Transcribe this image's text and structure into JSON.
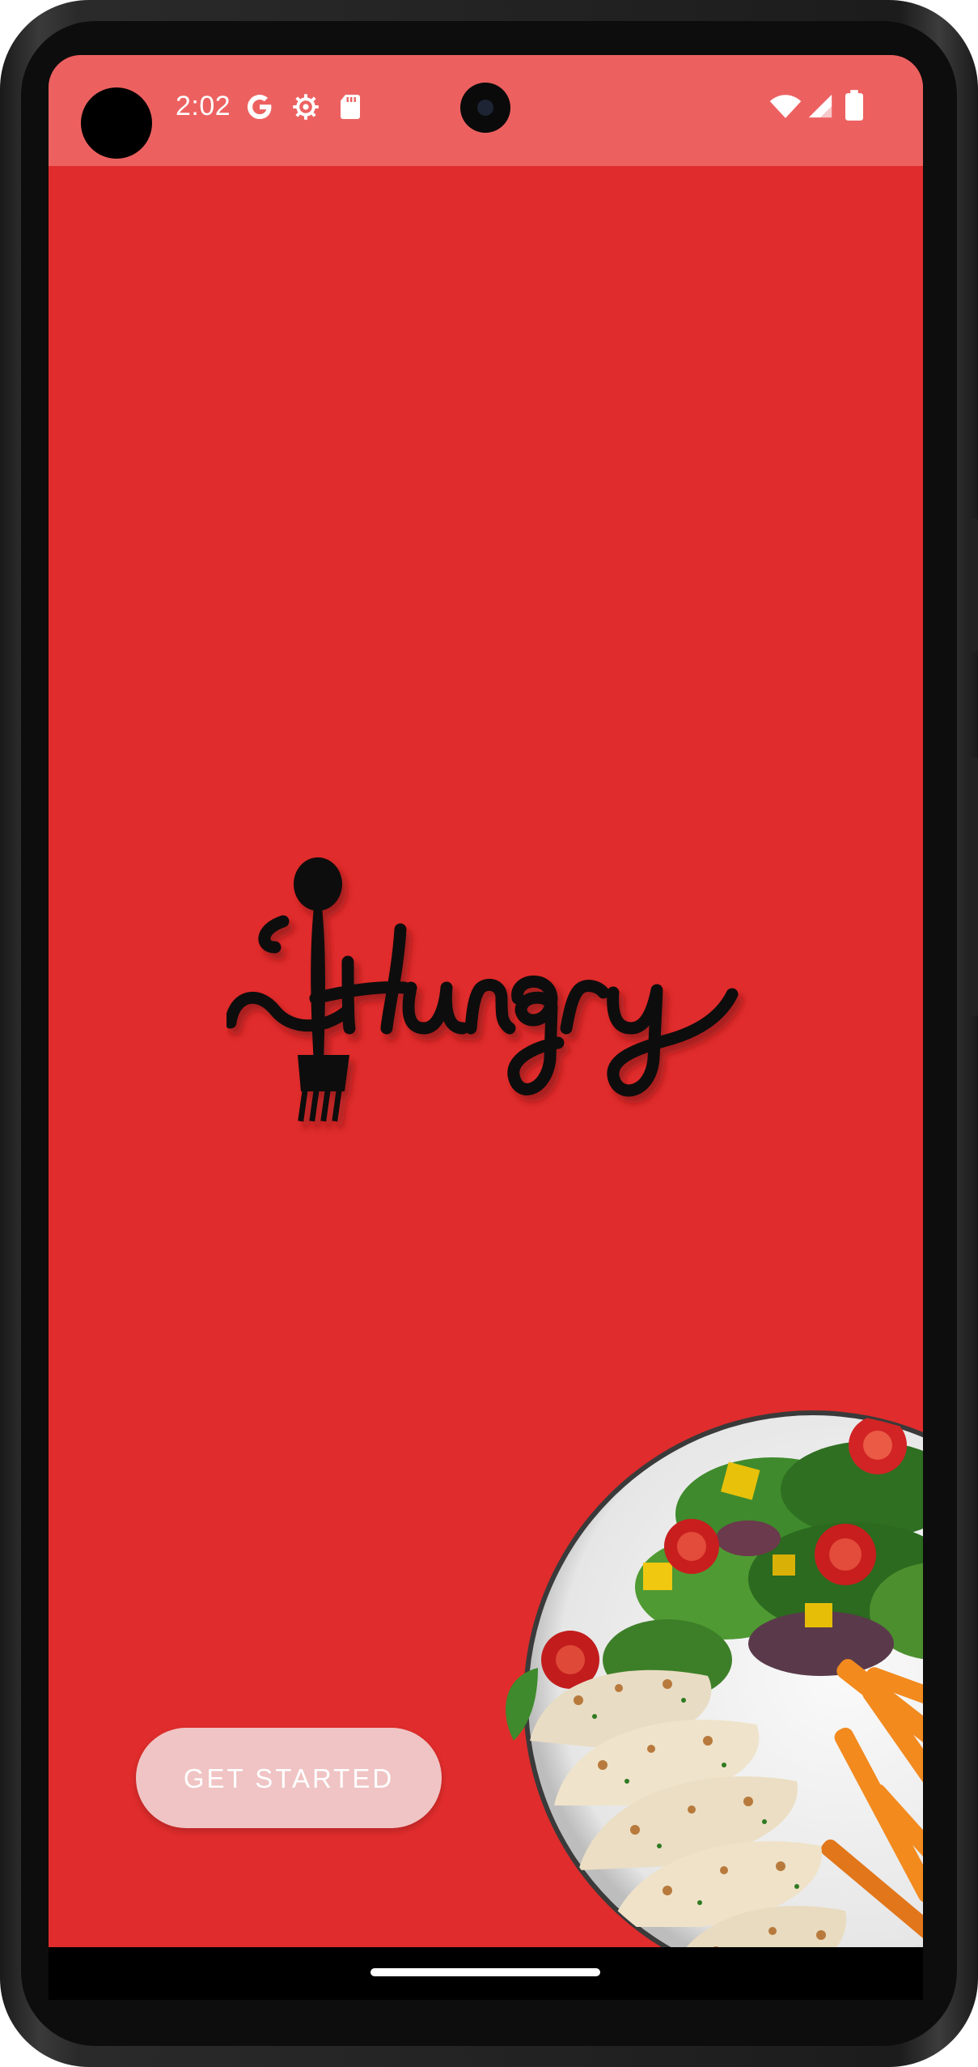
{
  "status_bar": {
    "time": "2:02",
    "left_icons": [
      "google-icon",
      "settings-icon",
      "sd-card-icon"
    ],
    "right_icons": [
      "wifi-icon",
      "cell-signal-icon",
      "battery-icon"
    ]
  },
  "brand": {
    "logo_text": "Hungry",
    "logo_icons": [
      "spoon-icon",
      "fork-icon"
    ]
  },
  "hero_image": "salad-and-chicken-plate",
  "cta": {
    "label": "GET STARTED"
  },
  "colors": {
    "background": "#e02c2c",
    "status_bar": "#ec6160",
    "button": "#f0c4c4",
    "button_text": "#ffffff"
  }
}
